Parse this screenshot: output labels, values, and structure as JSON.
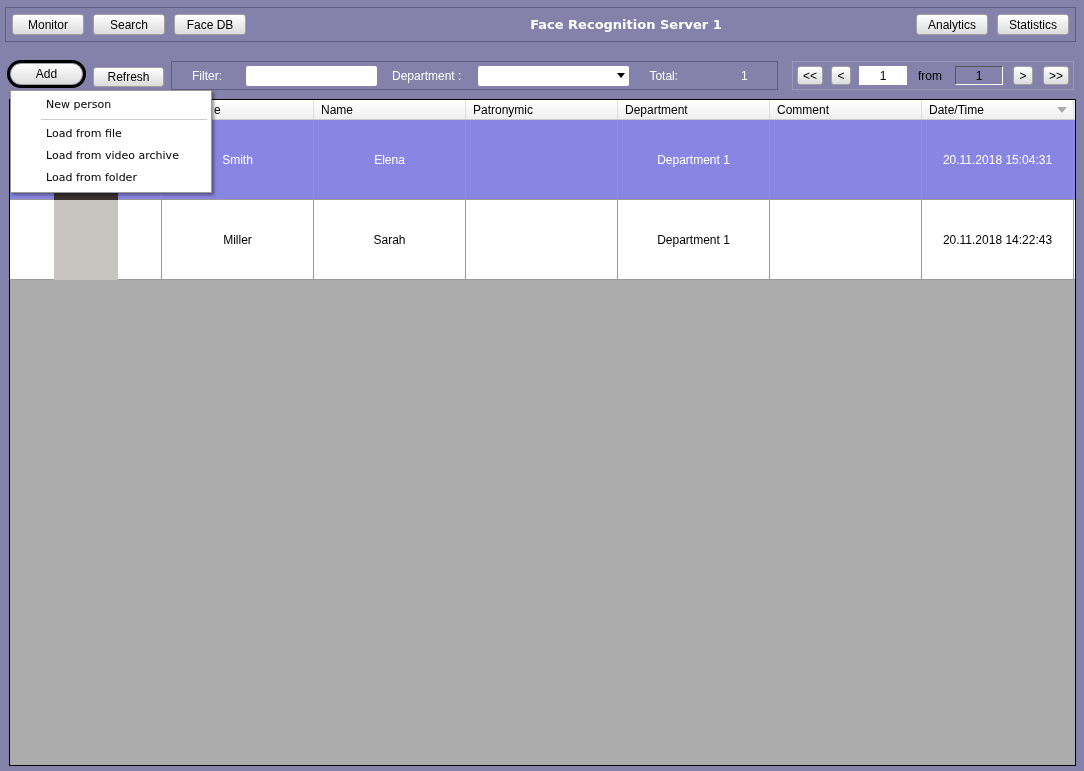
{
  "nav_buttons": [
    "Monitor",
    "Search",
    "Face DB"
  ],
  "title": "Face Recognition Server 1",
  "right_buttons": [
    "Analytics",
    "Statistics"
  ],
  "actions": {
    "add": "Add",
    "refresh": "Refresh",
    "add_highlighted": true
  },
  "filter": {
    "label": "Filter:",
    "department_label": "Department :",
    "total_label": "Total:",
    "total": "1"
  },
  "pager": {
    "first": "<<",
    "prev": "<",
    "page": "1",
    "from_label": "from",
    "pages": "1",
    "next": ">",
    "last": ">>"
  },
  "add_menu": [
    {
      "label": "New person",
      "kind": "item"
    },
    {
      "kind": "separator"
    },
    {
      "label": "Load from file",
      "kind": "item"
    },
    {
      "label": "Load from video archive",
      "kind": "item"
    },
    {
      "label": "Load from folder",
      "kind": "item"
    }
  ],
  "table": {
    "columns": [
      "",
      "e",
      "Name",
      "Patronymic",
      "Department",
      "Comment",
      "Date/Time"
    ],
    "rows": [
      {
        "selected": true,
        "cells": [
          "Smith",
          "Elena",
          "",
          "Department 1",
          "",
          "20.11.2018 15:04:31"
        ]
      },
      {
        "selected": false,
        "cells": [
          "Miller",
          "Sarah",
          "",
          "Department 1",
          "",
          "20.11.2018 14:22:43"
        ]
      }
    ]
  }
}
